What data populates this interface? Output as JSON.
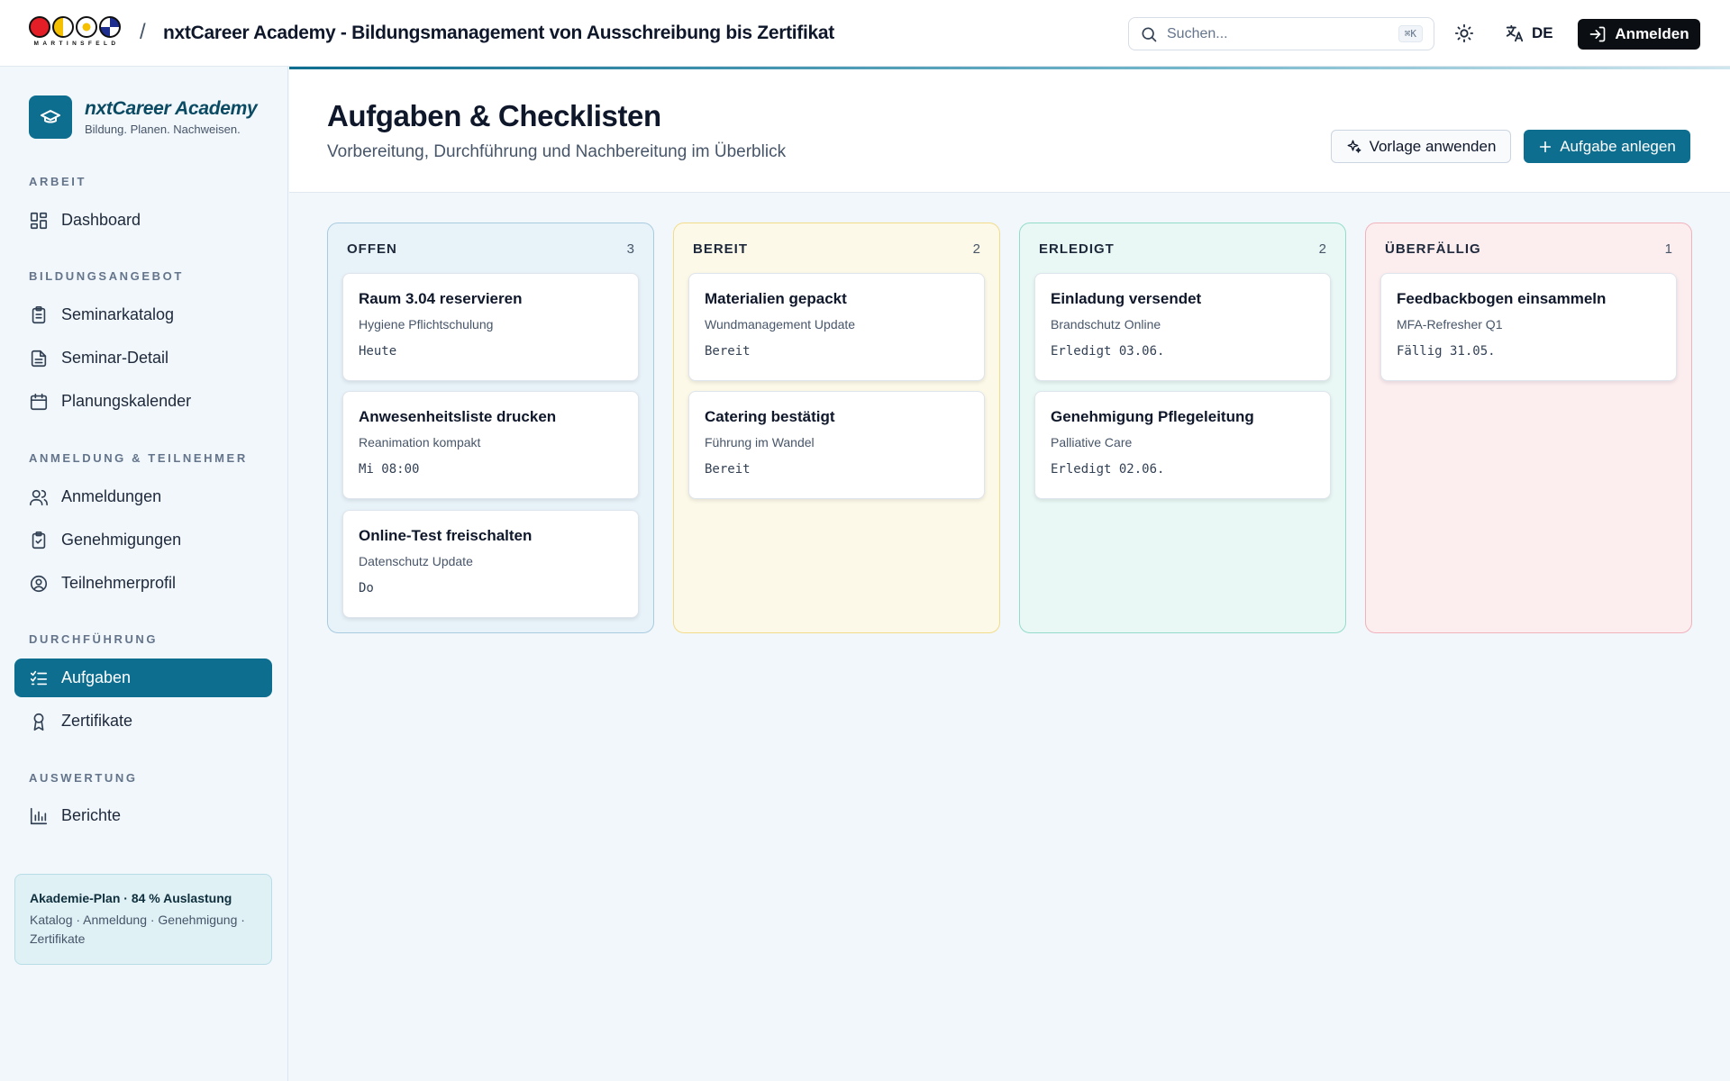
{
  "topbar": {
    "brand_word": "MARTINSFELD",
    "brand_colors": [
      "#e41e26",
      "#f5c000",
      "#ffffff",
      "#1d2e8f"
    ],
    "separator": "/",
    "title": "nxtCareer Academy - Bildungsmanagement von Ausschreibung bis Zertifikat",
    "search_placeholder": "Suchen...",
    "search_shortcut": "⌘K",
    "theme_icon": "sun-icon",
    "language": "DE",
    "login_label": "Anmelden"
  },
  "sidebar": {
    "brand_name": "nxtCareer Academy",
    "brand_tagline": "Bildung. Planen. Nachweisen.",
    "sections": {
      "arbeit": "ARBEIT",
      "bildungsangebot": "BILDUNGSANGEBOT",
      "anmeldung": "ANMELDUNG & TEILNEHMER",
      "durchfuehrung": "DURCHFÜHRUNG",
      "auswertung": "AUSWERTUNG"
    },
    "items": {
      "dashboard": "Dashboard",
      "seminarkatalog": "Seminarkatalog",
      "seminar_detail": "Seminar-Detail",
      "planungskalender": "Planungskalender",
      "anmeldungen": "Anmeldungen",
      "genehmigungen": "Genehmigungen",
      "teilnehmerprofil": "Teilnehmerprofil",
      "aufgaben": "Aufgaben",
      "zertifikate": "Zertifikate",
      "berichte": "Berichte"
    },
    "active_item": "aufgaben",
    "plan": {
      "title": "Akademie-Plan · 84 % Auslastung",
      "subtitle": "Katalog · Anmeldung · Genehmigung · Zertifikate"
    }
  },
  "main": {
    "title": "Aufgaben & Checklisten",
    "subtitle": "Vorbereitung, Durchführung und Nachbereitung im Überblick",
    "template_button": "Vorlage anwenden",
    "add_button": "Aufgabe anlegen"
  },
  "board": {
    "columns": [
      {
        "name": "OFFEN",
        "count": "3",
        "border": "#a9cbe0",
        "bg": "#e8f3f9",
        "cards": [
          {
            "title": "Raum 3.04 reservieren",
            "course": "Hygiene Pflichtschulung",
            "meta": "Heute"
          },
          {
            "title": "Anwesenheitsliste drucken",
            "course": "Reanimation kompakt",
            "meta": "Mi 08:00"
          },
          {
            "title": "Online-Test freischalten",
            "course": "Datenschutz Update",
            "meta": "Do"
          }
        ]
      },
      {
        "name": "BEREIT",
        "count": "2",
        "border": "#f2dc8a",
        "bg": "#fdf9e8",
        "cards": [
          {
            "title": "Materialien gepackt",
            "course": "Wundmanagement Update",
            "meta": "Bereit"
          },
          {
            "title": "Catering bestätigt",
            "course": "Führung im Wandel",
            "meta": "Bereit"
          }
        ]
      },
      {
        "name": "ERLEDIGT",
        "count": "2",
        "border": "#93dccb",
        "bg": "#e9f8f4",
        "cards": [
          {
            "title": "Einladung versendet",
            "course": "Brandschutz Online",
            "meta": "Erledigt 03.06."
          },
          {
            "title": "Genehmigung Pflegeleitung",
            "course": "Palliative Care",
            "meta": "Erledigt 02.06."
          }
        ]
      },
      {
        "name": "ÜBERFÄLLIG",
        "count": "1",
        "border": "#f1b2bb",
        "bg": "#fcedef",
        "cards": [
          {
            "title": "Feedbackbogen einsammeln",
            "course": "MFA-Refresher Q1",
            "meta": "Fällig 31.05."
          }
        ]
      }
    ]
  }
}
